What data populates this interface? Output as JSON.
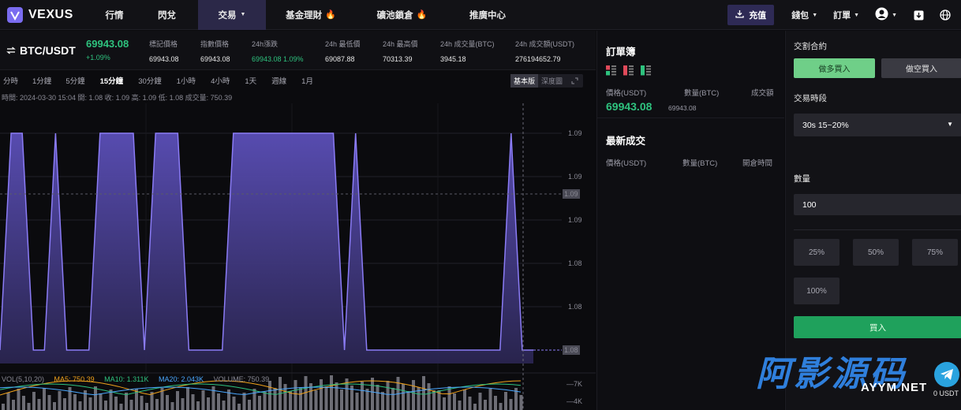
{
  "nav": {
    "brand": "VEXUS",
    "items": [
      {
        "label": "行情",
        "active": false,
        "caret": false,
        "hot": false
      },
      {
        "label": "閃兌",
        "active": false,
        "caret": false,
        "hot": false
      },
      {
        "label": "交易",
        "active": true,
        "caret": true,
        "hot": false
      },
      {
        "label": "基金理財",
        "active": false,
        "caret": false,
        "hot": true
      },
      {
        "label": "礦池鎖倉",
        "active": false,
        "caret": false,
        "hot": true
      },
      {
        "label": "推廣中心",
        "active": false,
        "caret": false,
        "hot": false
      }
    ],
    "recharge": "充值",
    "wallet": "錢包",
    "orders": "訂單"
  },
  "ticker": {
    "pair": "BTC/USDT",
    "last_price": "69943.08",
    "change": "+1.09%",
    "stats": [
      {
        "label": "標記價格",
        "value": "69943.08",
        "green": false
      },
      {
        "label": "指數價格",
        "value": "69943.08",
        "green": false
      },
      {
        "label": "24h漲跌",
        "value": "69943.08  1.09%",
        "green": true
      },
      {
        "label": "24h 最低價",
        "value": "69087.88",
        "green": false
      },
      {
        "label": "24h 最高價",
        "value": "70313.39",
        "green": false
      },
      {
        "label": "24h 成交量(BTC)",
        "value": "3945.18",
        "green": false
      },
      {
        "label": "24h 成交額(USDT)",
        "value": "276194652.79",
        "green": false
      }
    ]
  },
  "intervals": {
    "items": [
      "分時",
      "1分鐘",
      "5分鐘",
      "15分鐘",
      "30分鐘",
      "1小時",
      "4小時",
      "1天",
      "週線",
      "1月"
    ],
    "active": "15分鐘",
    "basic": "基本版",
    "depth": "深度圖"
  },
  "ohlc_line": "時間:  2024-03-30 15:04    開:  1.08    收:  1.09    高:  1.09    低:  1.08    成交量:  750.39",
  "chart_data": {
    "type": "area",
    "y_ticks": [
      "1.09",
      "1.09",
      "1.09",
      "1.08",
      "1.08"
    ],
    "current_label": "1.09",
    "last_label": "1.08",
    "ylim": [
      1.08,
      1.09
    ],
    "values": [
      1.08,
      1.09,
      1.09,
      1.08,
      1.08,
      1.09,
      1.08,
      1.08,
      1.08,
      1.09,
      1.09,
      1.09,
      1.09,
      1.08,
      1.09,
      1.09,
      1.09,
      1.08,
      1.08,
      1.08,
      1.08,
      1.09,
      1.09,
      1.09,
      1.09,
      1.09,
      1.09,
      1.09,
      1.09,
      1.09,
      1.09,
      1.08,
      1.09,
      1.08,
      1.08,
      1.08,
      1.08,
      1.08,
      1.08,
      1.08,
      1.08,
      1.08,
      1.08,
      1.08,
      1.08,
      1.08,
      1.09,
      1.08,
      1.08
    ]
  },
  "volume": {
    "legend": "VOL(5,10,20)",
    "ma5": "MA5: 750.39",
    "ma10": "MA10: 1.311K",
    "ma20": "MA20: 2.043K",
    "vol": "VOLUME: 750.39",
    "ticks": [
      "7K",
      "4K"
    ],
    "ma5_color": "#f0a21b",
    "ma10_color": "#2ec27e",
    "ma20_color": "#4aa8ff",
    "vol_color": "#8a8a95"
  },
  "orderbook": {
    "title": "訂單簿",
    "col_price": "價格(USDT)",
    "col_qty": "數量(BTC)",
    "col_total": "成交額",
    "price": "69943.08",
    "sub": "69943.08"
  },
  "trades": {
    "title": "最新成交",
    "col_price": "價格(USDT)",
    "col_qty": "數量(BTC)",
    "col_time": "開倉時間"
  },
  "trade_panel": {
    "title": "交割合約",
    "long": "做多買入",
    "short": "做空買入",
    "period_label": "交易時段",
    "period_value": "30s 15~20%",
    "qty_label": "數量",
    "qty_value": "100",
    "percents": [
      "25%",
      "50%",
      "75%",
      "100%"
    ],
    "buy": "買入",
    "balance": "0 USDT"
  },
  "watermark": {
    "main": "阿影源码",
    "url": "AYYM.NET"
  },
  "colors": {
    "accent": "#7a6cf0",
    "up": "#2ec27e",
    "nav_active": "#2b2848"
  }
}
